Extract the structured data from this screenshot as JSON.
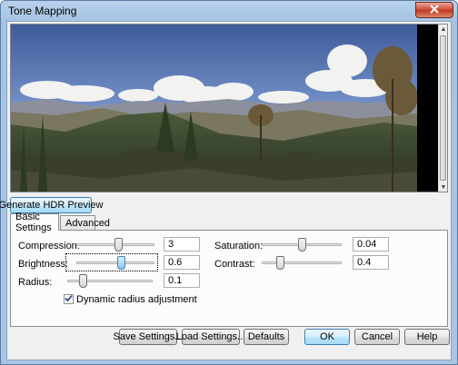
{
  "window": {
    "title": "Tone Mapping"
  },
  "preview": {
    "generate_button": "Generate HDR Preview"
  },
  "tabs": [
    {
      "label": "Basic Settings"
    },
    {
      "label": "Advanced"
    }
  ],
  "settings": {
    "compression": {
      "label": "Compression:",
      "value": "3",
      "slider_position": 0.55
    },
    "brightness": {
      "label": "Brightness:",
      "value": "0.6",
      "slider_position": 0.58
    },
    "radius": {
      "label": "Radius:",
      "value": "0.1",
      "slider_position": 0.15
    },
    "saturation": {
      "label": "Saturation:",
      "value": "0.04",
      "slider_position": 0.5
    },
    "contrast": {
      "label": "Contrast:",
      "value": "0.4",
      "slider_position": 0.2
    },
    "dynamic_radius": {
      "label": "Dynamic radius adjustment",
      "checked": true
    }
  },
  "buttons": {
    "save": "Save Settings...",
    "load": "Load Settings...",
    "defaults": "Defaults",
    "ok": "OK",
    "cancel": "Cancel",
    "help": "Help"
  },
  "icons": {
    "close": "close-icon",
    "checkmark": "checkmark-icon"
  }
}
